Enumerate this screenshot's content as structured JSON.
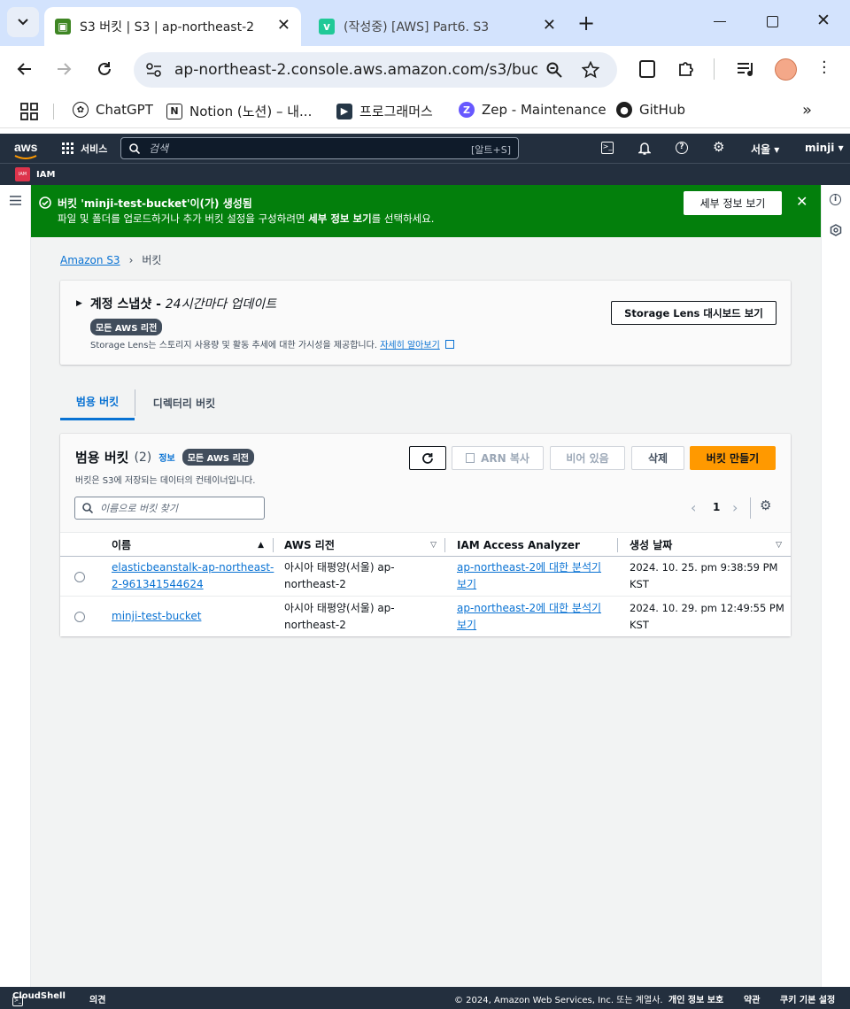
{
  "browser": {
    "tabs": [
      {
        "title": "S3 버킷 | S3 | ap-northeast-2",
        "active": true
      },
      {
        "title": "(작성중) [AWS] Part6. S3",
        "active": false
      }
    ],
    "url": "ap-northeast-2.console.aws.amazon.com/s3/buck...",
    "bookmarks": [
      {
        "label": "ChatGPT"
      },
      {
        "label": "Notion (노션) – 내..."
      },
      {
        "label": "프로그래머스"
      },
      {
        "label": "Zep - Maintenance"
      },
      {
        "label": "GitHub"
      }
    ]
  },
  "aws_nav": {
    "logo": "aws",
    "services": "서비스",
    "search_placeholder": "검색",
    "search_shortcut": "[알트+S]",
    "region": "서울 ▾",
    "user": "minji ▾",
    "favorite_service": "IAM",
    "favorite_service_icon": "IAM"
  },
  "flash": {
    "title": "버킷 'minji-test-bucket'이(가) 생성됨",
    "message_pre": "파일 및 폴더를 업로드하거나 추가 버킷 설정을 구성하려면 ",
    "message_bold": "세부 정보 보기",
    "message_post": "를 선택하세요.",
    "button": "세부 정보 보기"
  },
  "breadcrumb": {
    "root": "Amazon S3",
    "current": "버킷"
  },
  "snapshot": {
    "title": "계정 스냅샷 - ",
    "title_italic": "24시간마다 업데이트",
    "badge": "모든 AWS 리전",
    "description": "Storage Lens는 스토리지 사용량 및 활동 추세에 대한 가시성을 제공합니다. ",
    "learn_more": "자세히 알아보기",
    "button": "Storage Lens 대시보드 보기"
  },
  "tabs": [
    {
      "label": "범용 버킷",
      "active": true
    },
    {
      "label": "디렉터리 버킷",
      "active": false
    }
  ],
  "buckets_panel": {
    "title": "범용 버킷",
    "count": "(2)",
    "info": "정보",
    "badge": "모든 AWS 리전",
    "description": "버킷은 S3에 저장되는 데이터의 컨테이너입니다.",
    "actions": {
      "copy_arn": "ARN 복사",
      "empty": "비어 있음",
      "delete": "삭제",
      "create": "버킷 만들기"
    },
    "search_placeholder": "이름으로 버킷 찾기",
    "page": "1",
    "columns": [
      "이름",
      "AWS 리전",
      "IAM Access Analyzer",
      "생성 날짜"
    ],
    "rows": [
      {
        "name_l1": "elasticbeanstalk-ap-northeast-",
        "name_l2": "2-961341544624",
        "region_l1": "아시아 태평양(서울) ap-",
        "region_l2": "northeast-2",
        "analyzer_l1": "ap-northeast-2에 대한 분석기",
        "analyzer_l2": "보기",
        "created_l1": "2024. 10. 25. pm 9:38:59 PM",
        "created_l2": "KST"
      },
      {
        "name_l1": "minji-test-bucket",
        "name_l2": "",
        "region_l1": "아시아 태평양(서울) ap-",
        "region_l2": "northeast-2",
        "analyzer_l1": "ap-northeast-2에 대한 분석기",
        "analyzer_l2": "보기",
        "created_l1": "2024. 10. 29. pm 12:49:55 PM",
        "created_l2": "KST"
      }
    ]
  },
  "footer": {
    "cloudshell": "CloudShell",
    "feedback": "의견",
    "copyright": "© 2024, Amazon Web Services, Inc. 또는 계열사.",
    "privacy": "개인 정보 보호",
    "terms": "약관",
    "cookies": "쿠키 기본 설정"
  },
  "colors": {
    "success": "#037f0c",
    "primary": "#ff9900",
    "link": "#0972d3",
    "nav": "#232f3e"
  }
}
